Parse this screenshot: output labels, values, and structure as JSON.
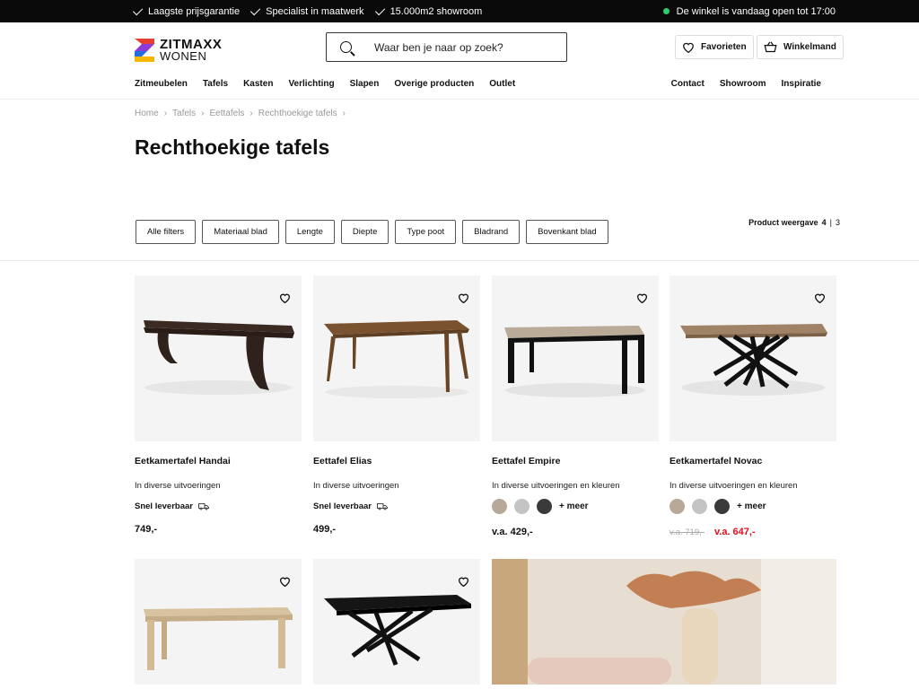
{
  "topbar": {
    "usps": [
      "Laagste prijsgarantie",
      "Specialist in maatwerk",
      "15.000m2 showroom"
    ],
    "open_text": "De winkel is vandaag open tot 17:00"
  },
  "logo": {
    "brand": "ZITMAXX",
    "sub": "WONEN"
  },
  "search": {
    "placeholder": "Waar ben je naar op zoek?"
  },
  "header": {
    "favorites": "Favorieten",
    "cart": "Winkelmand"
  },
  "nav": {
    "left": [
      "Zitmeubelen",
      "Tafels",
      "Kasten",
      "Verlichting",
      "Slapen",
      "Overige producten",
      "Outlet"
    ],
    "right": [
      "Contact",
      "Showroom",
      "Inspiratie"
    ]
  },
  "breadcrumb": [
    "Home",
    "Tafels",
    "Eettafels",
    "Rechthoekige tafels"
  ],
  "page_title": "Rechthoekige tafels",
  "filters": [
    "Alle filters",
    "Materiaal blad",
    "Lengte",
    "Diepte",
    "Type poot",
    "Bladrand",
    "Bovenkant blad"
  ],
  "view": {
    "label": "Product weergave",
    "active": "4",
    "sep": "|",
    "other": "3"
  },
  "products": [
    {
      "name": "Eetkamertafel Handai",
      "variant": "In diverse uitvoeringen",
      "delivery": "Snel leverbaar",
      "price": "749,-"
    },
    {
      "name": "Eettafel Elias",
      "variant": "In diverse uitvoeringen",
      "delivery": "Snel leverbaar",
      "price": "499,-"
    },
    {
      "name": "Eettafel Empire",
      "variant": "In diverse uitvoeringen en kleuren",
      "more": "+ meer",
      "price": "v.a. 429,-"
    },
    {
      "name": "Eetkamertafel Novac",
      "variant": "In diverse uitvoeringen en kleuren",
      "more": "+ meer",
      "old_price": "v.a. 719,-",
      "price": "v.a. 647,-"
    }
  ],
  "colors": {
    "swatch1": "#b7a898",
    "swatch2": "#c4c4c4",
    "swatch3": "#3a3a3a",
    "sale": "#e0101b",
    "open_dot": "#2ecc71"
  }
}
